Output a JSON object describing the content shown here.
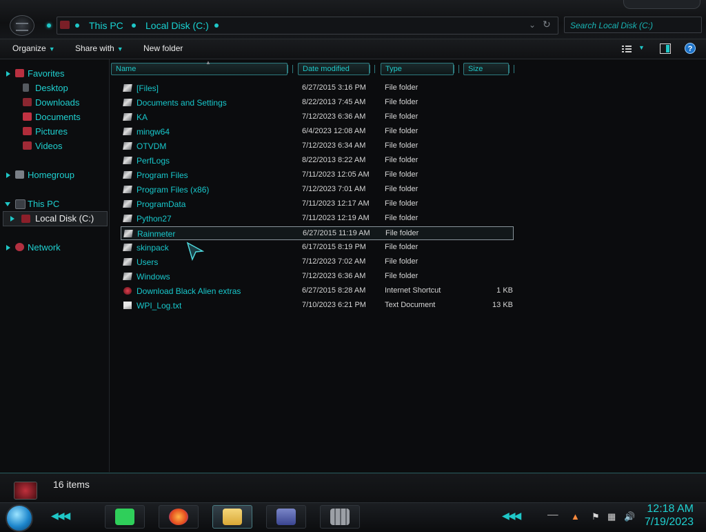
{
  "address": {
    "crumbs": [
      "This PC",
      "Local Disk (C:)"
    ]
  },
  "search": {
    "placeholder": "Search Local Disk (C:)"
  },
  "toolbar": {
    "organize_label": "Organize",
    "share_label": "Share with",
    "new_folder_label": "New folder"
  },
  "sidebar": {
    "favorites": "Favorites",
    "favorites_items": [
      "Desktop",
      "Downloads",
      "Documents",
      "Pictures",
      "Videos"
    ],
    "homegroup": "Homegroup",
    "this_pc": "This PC",
    "this_pc_items": [
      "Local Disk (C:)"
    ],
    "network": "Network"
  },
  "columns": {
    "name": "Name",
    "date_modified": "Date modified",
    "type": "Type",
    "size": "Size"
  },
  "files": [
    {
      "name": "[Files]",
      "date": "6/27/2015 3:16 PM",
      "type": "File folder",
      "size": ""
    },
    {
      "name": "Documents and Settings",
      "date": "8/22/2013 7:45 AM",
      "type": "File folder",
      "size": ""
    },
    {
      "name": "KA",
      "date": "7/12/2023 6:36 AM",
      "type": "File folder",
      "size": ""
    },
    {
      "name": "mingw64",
      "date": "6/4/2023 12:08 AM",
      "type": "File folder",
      "size": ""
    },
    {
      "name": "OTVDM",
      "date": "7/12/2023 6:34 AM",
      "type": "File folder",
      "size": ""
    },
    {
      "name": "PerfLogs",
      "date": "8/22/2013 8:22 AM",
      "type": "File folder",
      "size": ""
    },
    {
      "name": "Program Files",
      "date": "7/11/2023 12:05 AM",
      "type": "File folder",
      "size": ""
    },
    {
      "name": "Program Files (x86)",
      "date": "7/12/2023 7:01 AM",
      "type": "File folder",
      "size": ""
    },
    {
      "name": "ProgramData",
      "date": "7/11/2023 12:17 AM",
      "type": "File folder",
      "size": ""
    },
    {
      "name": "Python27",
      "date": "7/11/2023 12:19 AM",
      "type": "File folder",
      "size": ""
    },
    {
      "name": "Rainmeter",
      "date": "6/27/2015 11:19 AM",
      "type": "File folder",
      "size": ""
    },
    {
      "name": "skinpack",
      "date": "6/17/2015 8:19 PM",
      "type": "File folder",
      "size": ""
    },
    {
      "name": "Users",
      "date": "7/12/2023 7:02 AM",
      "type": "File folder",
      "size": ""
    },
    {
      "name": "Windows",
      "date": "7/12/2023 6:36 AM",
      "type": "File folder",
      "size": ""
    },
    {
      "name": "Download Black Alien extras",
      "date": "6/27/2015 8:28 AM",
      "type": "Internet Shortcut",
      "size": "1 KB"
    },
    {
      "name": "WPI_Log.txt",
      "date": "7/10/2023 6:21 PM",
      "type": "Text Document",
      "size": "13 KB"
    }
  ],
  "status": {
    "item_count": "16 items"
  },
  "clock": {
    "time": "12:18 AM",
    "date": "7/19/2023"
  },
  "colors": {
    "accent": "#1fd0d0",
    "background": "#0b0c0e"
  }
}
